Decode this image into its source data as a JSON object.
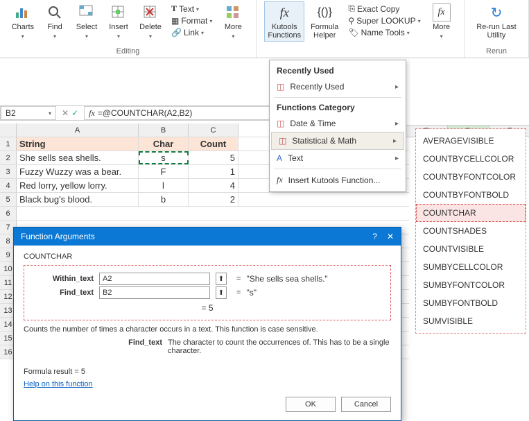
{
  "ribbon": {
    "charts": "Charts",
    "find": "Find",
    "select": "Select",
    "insert": "Insert",
    "delete": "Delete",
    "text": "Text",
    "format": "Format",
    "link": "Link",
    "more1": "More",
    "editing_group": "Editing",
    "kutools": "Kutools\nFunctions",
    "formula_helper": "Formula\nHelper",
    "exact_copy": "Exact Copy",
    "super_lookup": "Super LOOKUP",
    "name_tools": "Name Tools",
    "more2": "More",
    "rerun": "Re-run Last\nUtility",
    "rerun_group": "Rerun"
  },
  "cell": {
    "name": "B2",
    "formula": "=@COUNTCHAR(A2,B2)"
  },
  "headers": {
    "A": "A",
    "B": "B",
    "C": "C",
    "R": "R",
    "S": "S",
    "T": "T"
  },
  "table": {
    "row1": {
      "A": "String",
      "B": "Char",
      "C": "Count"
    },
    "rows": [
      {
        "n": "2",
        "A": "She sells sea shells.",
        "B": "s",
        "C": "5"
      },
      {
        "n": "3",
        "A": "Fuzzy Wuzzy was a bear.",
        "B": "F",
        "C": "1"
      },
      {
        "n": "4",
        "A": "Red lorry, yellow lorry.",
        "B": "l",
        "C": "4"
      },
      {
        "n": "5",
        "A": "Black bug's blood.",
        "B": "b",
        "C": "2"
      }
    ]
  },
  "dropdown": {
    "recently_used_hdr": "Recently Used",
    "recently_used": "Recently Used",
    "category_hdr": "Functions Category",
    "date_time": "Date & Time",
    "stat_math": "Statistical & Math",
    "text": "Text",
    "insert_fn": "Insert Kutools Function..."
  },
  "submenu": [
    "AVERAGEVISIBLE",
    "COUNTBYCELLCOLOR",
    "COUNTBYFONTCOLOR",
    "COUNTBYFONTBOLD",
    "COUNTCHAR",
    "COUNTSHADES",
    "COUNTVISIBLE",
    "SUMBYCELLCOLOR",
    "SUMBYFONTCOLOR",
    "SUMBYFONTBOLD",
    "SUMVISIBLE"
  ],
  "dialog": {
    "title": "Function Arguments",
    "fn": "COUNTCHAR",
    "arg1_label": "Within_text",
    "arg1_val": "A2",
    "arg1_result": "\"She sells sea shells.\"",
    "arg2_label": "Find_text",
    "arg2_val": "B2",
    "arg2_result": "\"s\"",
    "calc_eq": "=  5",
    "desc": "Counts the number of times a character occurs in a text. This function is case sensitive.",
    "param_label": "Find_text",
    "param_desc": "The character to count the occurrences of. This has to be a single character.",
    "formula_result": "Formula result =   5",
    "help": "Help on this function",
    "ok": "OK",
    "cancel": "Cancel"
  }
}
